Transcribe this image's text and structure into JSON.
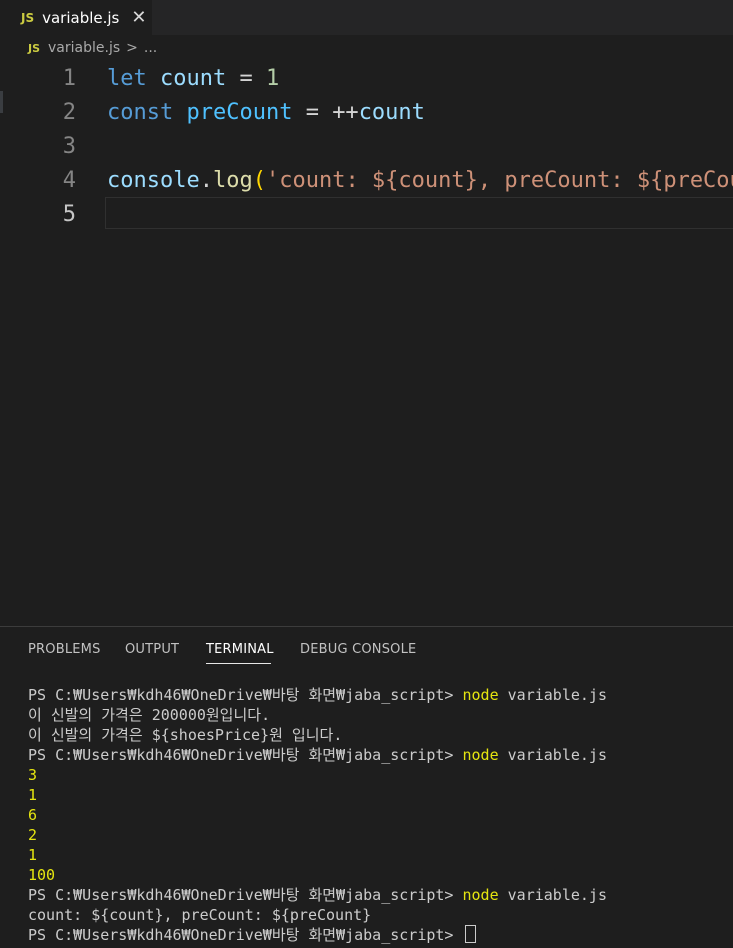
{
  "tab": {
    "badge": "JS",
    "title": "variable.js",
    "close": "✕"
  },
  "breadcrumb": {
    "badge": "JS",
    "file": "variable.js",
    "sep": ">",
    "more": "..."
  },
  "editor": {
    "lines": [
      {
        "num": "1",
        "tokens": [
          [
            "kw",
            "let"
          ],
          [
            "op",
            " "
          ],
          [
            "var",
            "count"
          ],
          [
            "op",
            " = "
          ],
          [
            "num",
            "1"
          ]
        ]
      },
      {
        "num": "2",
        "tokens": [
          [
            "kw",
            "const"
          ],
          [
            "op",
            " "
          ],
          [
            "ident",
            "preCount"
          ],
          [
            "op",
            " = ++"
          ],
          [
            "var",
            "count"
          ]
        ]
      },
      {
        "num": "3",
        "tokens": []
      },
      {
        "num": "4",
        "tokens": [
          [
            "var",
            "console"
          ],
          [
            "op",
            "."
          ],
          [
            "fn",
            "log"
          ],
          [
            "paren",
            "("
          ],
          [
            "str",
            "'count: ${count}, preCount: ${preCount}'"
          ]
        ]
      },
      {
        "num": "5",
        "tokens": []
      }
    ],
    "active_line": "5"
  },
  "panel": {
    "tabs": [
      "PROBLEMS",
      "OUTPUT",
      "TERMINAL",
      "DEBUG CONSOLE"
    ],
    "active_tab": "TERMINAL"
  },
  "terminal": {
    "prompt": "PS C:₩Users₩kdh46₩OneDrive₩바탕 화면₩jaba_script>",
    "command": "node",
    "arg": "variable.js",
    "lines": [
      {
        "kind": "cmd"
      },
      {
        "kind": "text",
        "text": "이 신발의 가격은 200000원입니다."
      },
      {
        "kind": "text",
        "text": "이 신발의 가격은 ${shoesPrice}원 입니다."
      },
      {
        "kind": "cmd"
      },
      {
        "kind": "out",
        "text": "3"
      },
      {
        "kind": "out",
        "text": "1"
      },
      {
        "kind": "out",
        "text": "6"
      },
      {
        "kind": "out",
        "text": "2"
      },
      {
        "kind": "out",
        "text": "1"
      },
      {
        "kind": "out",
        "text": "100"
      },
      {
        "kind": "cmd"
      },
      {
        "kind": "text",
        "text": "count: ${count}, preCount: ${preCount}"
      },
      {
        "kind": "prompt"
      }
    ]
  },
  "colors": {
    "editor_bg": "#1e1e1e",
    "tabbar_bg": "#252526",
    "keyword": "#569cd6",
    "variable": "#9cdcfe",
    "number": "#b5cea8",
    "function": "#dcdcaa",
    "string": "#ce9178",
    "terminal_highlight": "#e5e510"
  }
}
